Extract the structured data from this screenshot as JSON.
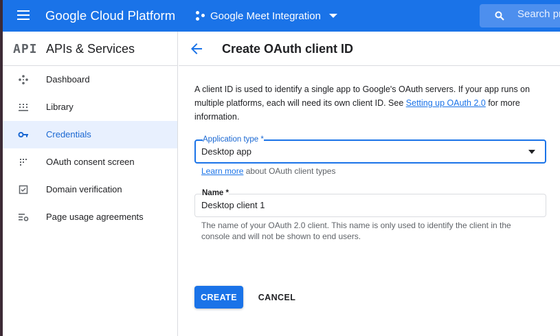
{
  "topbar": {
    "brand": "Google Cloud Platform",
    "project_name": "Google Meet Integration",
    "search_placeholder": "Search pr"
  },
  "sidebar": {
    "logo_text": "API",
    "title": "APIs & Services",
    "items": [
      {
        "label": "Dashboard",
        "icon": "dashboard-icon",
        "active": false
      },
      {
        "label": "Library",
        "icon": "library-icon",
        "active": false
      },
      {
        "label": "Credentials",
        "icon": "key-icon",
        "active": true
      },
      {
        "label": "OAuth consent screen",
        "icon": "consent-icon",
        "active": false
      },
      {
        "label": "Domain verification",
        "icon": "checkbox-icon",
        "active": false
      },
      {
        "label": "Page usage agreements",
        "icon": "settings-list-icon",
        "active": false
      }
    ]
  },
  "page": {
    "title": "Create OAuth client ID",
    "description_before": "A client ID is used to identify a single app to Google's OAuth servers. If your app runs on multiple platforms, each will need its own client ID. See ",
    "description_link": "Setting up OAuth 2.0",
    "description_after": " for more information."
  },
  "form": {
    "app_type_label": "Application type *",
    "app_type_value": "Desktop app",
    "learn_more_link": "Learn more",
    "learn_more_rest": " about OAuth client types",
    "name_label": "Name *",
    "name_value": "Desktop client 1",
    "name_hint": "The name of your OAuth 2.0 client. This name is only used to identify the client in the console and will not be shown to end users.",
    "create_label": "CREATE",
    "cancel_label": "CANCEL"
  },
  "colors": {
    "accent": "#1a73e8",
    "active_bg": "#e8f0fe",
    "active_text": "#1967d2"
  }
}
